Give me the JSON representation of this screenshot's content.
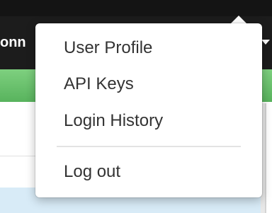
{
  "navbar": {
    "partial_label": "onn",
    "dropdown_caret": "caret-down-icon"
  },
  "user_menu": {
    "items": [
      {
        "label": "User Profile"
      },
      {
        "label": "API Keys"
      },
      {
        "label": "Login History"
      }
    ],
    "logout_label": "Log out"
  },
  "colors": {
    "navbar_bg": "#1c1c1c",
    "accent_green": "#5cb85c",
    "menu_text": "#333333",
    "row_highlight": "#d8ebf7"
  }
}
